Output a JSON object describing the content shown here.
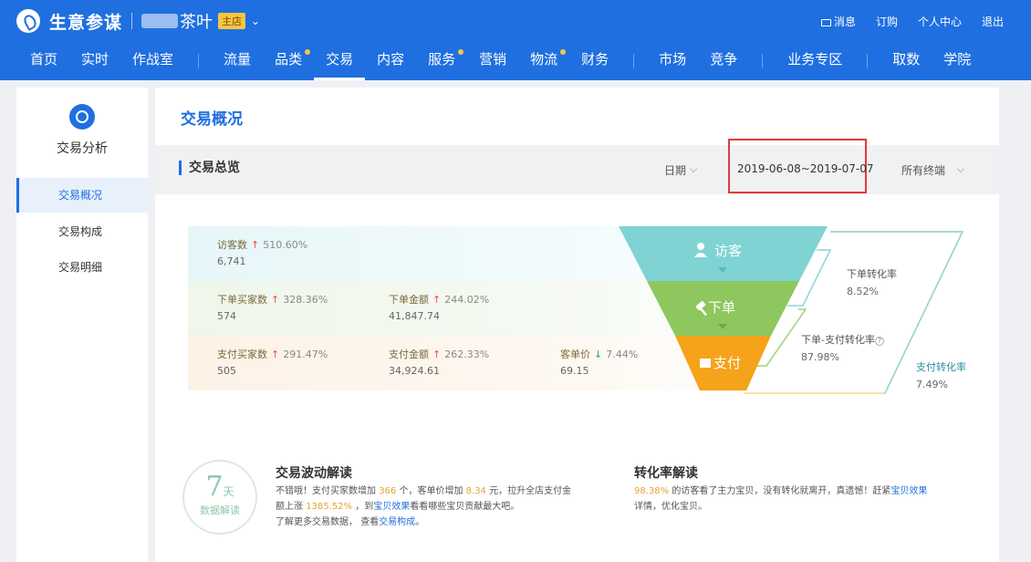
{
  "header": {
    "brand": "生意参谋",
    "shop_name": "茶叶",
    "shop_badge": "主店",
    "links": [
      "消息",
      "订购",
      "个人中心",
      "退出"
    ]
  },
  "nav": [
    "首页",
    "实时",
    "作战室",
    "流量",
    "品类",
    "交易",
    "内容",
    "服务",
    "营销",
    "物流",
    "财务",
    "市场",
    "竞争",
    "业务专区",
    "取数",
    "学院"
  ],
  "sidebar": {
    "title": "交易分析",
    "items": [
      "交易概况",
      "交易构成",
      "交易明细"
    ]
  },
  "main": {
    "title": "交易概况",
    "section": "交易总览",
    "date_label": "日期",
    "date_range": "2019-06-08~2019-07-07",
    "device": "所有终端"
  },
  "stats": {
    "visitors": {
      "label": "访客数",
      "change": "510.60%",
      "value": "6,741"
    },
    "order_buyers": {
      "label": "下单买家数",
      "change": "328.36%",
      "value": "574"
    },
    "order_amount": {
      "label": "下单金额",
      "change": "244.02%",
      "value": "41,847.74"
    },
    "pay_buyers": {
      "label": "支付买家数",
      "change": "291.47%",
      "value": "505"
    },
    "pay_amount": {
      "label": "支付金额",
      "change": "262.33%",
      "value": "34,924.61"
    },
    "unit_price": {
      "label": "客单价",
      "change": "7.44%",
      "value": "69.15"
    }
  },
  "funnel": {
    "stages": [
      "访客",
      "下单",
      "支付"
    ],
    "colors": [
      "#7fd3d3",
      "#8dc75e",
      "#f5a31a"
    ],
    "rates": {
      "order_rate": {
        "label": "下单转化率",
        "value": "8.52%"
      },
      "order_pay_rate": {
        "label": "下单-支付转化率",
        "value": "87.98%"
      },
      "pay_rate": {
        "label": "支付转化率",
        "value": "7.49%"
      }
    }
  },
  "badge": {
    "num": "7",
    "unit": "天",
    "text": "数据解读"
  },
  "interp1": {
    "title": "交易波动解读",
    "t1": "不错哦！支付买家数增加",
    "v1": "366",
    "t2": "个，客单价增加",
    "v2": "8.34",
    "t3": "元，拉升全店支付金",
    "t4": "额上涨",
    "v3": "1385.52%",
    "t5": "，到",
    "l1": "宝贝效果",
    "t6": "看看哪些宝贝贡献最大吧。",
    "t7": "了解更多交易数据，",
    "t8": "查看",
    "l2": "交易构成",
    "t9": "。"
  },
  "interp2": {
    "title": "转化率解读",
    "v1": "98.38%",
    "t1": "的访客看了主力宝贝，没有转化就离开，真遗憾！赶紧",
    "l1": "宝贝效果",
    "t2": "详情，优化宝贝。"
  }
}
